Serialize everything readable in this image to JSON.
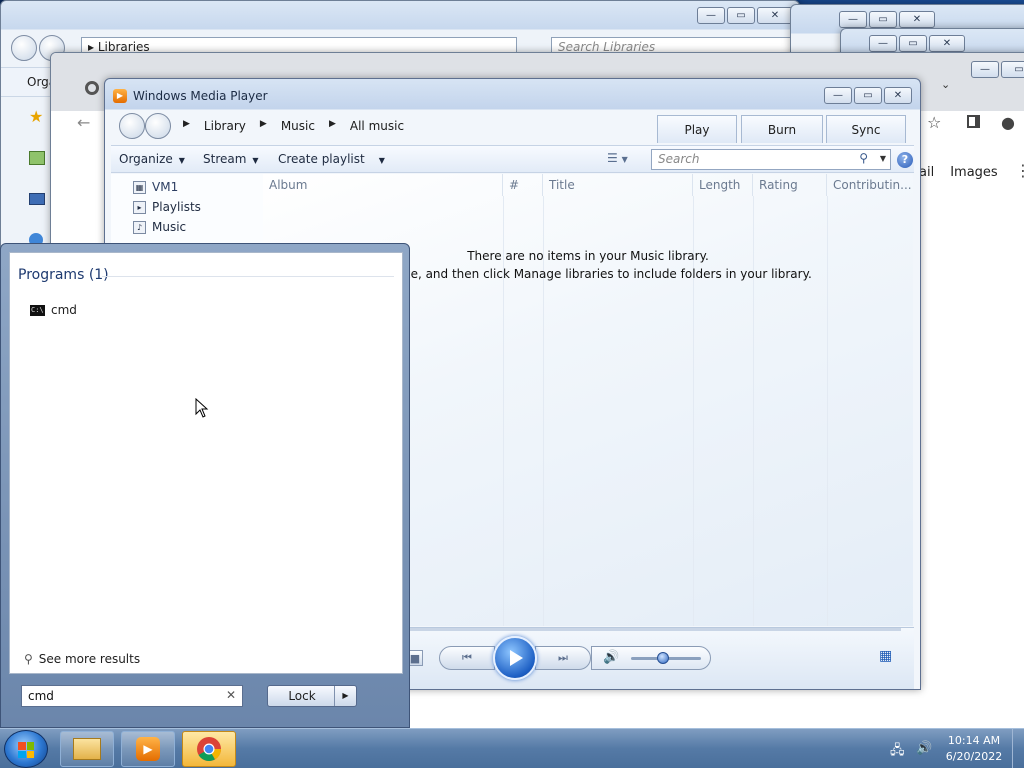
{
  "explorer": {
    "address": "Libraries",
    "search_placeholder": "Search Libraries",
    "organize_label": "Orga"
  },
  "chrome": {
    "tab_labels": [
      "ail",
      "Images"
    ]
  },
  "wmp": {
    "title": "Windows Media Player",
    "breadcrumbs": [
      "Library",
      "Music",
      "All music"
    ],
    "tabs": [
      "Play",
      "Burn",
      "Sync"
    ],
    "toolbar": {
      "organize": "Organize",
      "stream": "Stream",
      "create_playlist": "Create playlist"
    },
    "search_placeholder": "Search",
    "nav": [
      "VM1",
      "Playlists",
      "Music"
    ],
    "columns": [
      "Album",
      "#",
      "Title",
      "Length",
      "Rating",
      "Contributin..."
    ],
    "empty_line1": "There are no items in your Music library.",
    "empty_line2": "Organize, and then click Manage libraries to include folders in your library.",
    "volume_fraction": 0.45
  },
  "startmenu": {
    "header": "Programs (1)",
    "results": [
      "cmd"
    ],
    "see_more": "See more results",
    "search_value": "cmd",
    "lock_label": "Lock"
  },
  "taskbar": {
    "time": "10:14 AM",
    "date": "6/20/2022"
  }
}
